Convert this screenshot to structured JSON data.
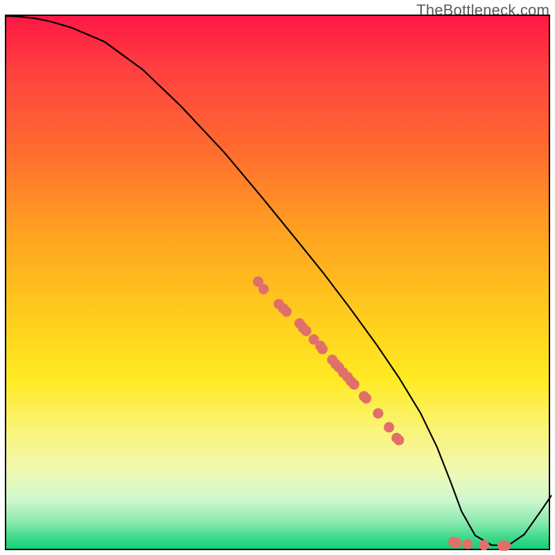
{
  "watermark": "TheBottleneck.com",
  "colors": {
    "frame_border": "#000000",
    "curve": "#000000",
    "dot_fill": "#e06f6a",
    "gradient_top": "#ff1744",
    "gradient_bottom": "#16d07a"
  },
  "chart_data": {
    "type": "line",
    "title": "",
    "xlabel": "",
    "ylabel": "",
    "xlim": [
      0,
      100
    ],
    "ylim": [
      0,
      100
    ],
    "grid": false,
    "legend": false,
    "series": [
      {
        "name": "curve",
        "x": [
          0,
          2,
          5,
          8,
          12,
          18,
          25,
          32,
          40,
          47,
          53,
          58,
          63,
          68,
          72,
          76,
          79,
          81.5,
          83.5,
          86,
          89,
          92,
          95,
          98,
          100
        ],
        "values": [
          100,
          99.9,
          99.6,
          99.0,
          97.8,
          95.2,
          90.0,
          83.2,
          74.5,
          66.0,
          58.5,
          52.2,
          45.5,
          38.5,
          32.5,
          25.8,
          19.5,
          13.0,
          7.5,
          3.0,
          1.2,
          1.1,
          3.2,
          7.5,
          10.5
        ]
      }
    ],
    "scatter": {
      "name": "dots",
      "x": [
        46.2,
        47.2,
        50.0,
        50.8,
        51.4,
        53.8,
        54.4,
        55.0,
        56.4,
        57.6,
        58.0,
        59.8,
        60.4,
        61.0,
        61.8,
        62.6,
        63.2,
        63.8,
        65.6,
        66.0,
        68.2,
        70.2,
        71.6,
        72.0,
        82.0,
        82.6,
        84.6,
        87.6,
        91.0,
        91.6
      ],
      "values": [
        50.4,
        49.0,
        46.2,
        45.4,
        44.8,
        42.6,
        41.8,
        41.2,
        39.6,
        38.4,
        37.8,
        35.8,
        35.0,
        34.4,
        33.4,
        32.6,
        31.8,
        31.2,
        29.0,
        28.6,
        25.8,
        23.2,
        21.2,
        20.8,
        1.8,
        1.6,
        1.4,
        1.2,
        1.1,
        1.1
      ]
    }
  }
}
